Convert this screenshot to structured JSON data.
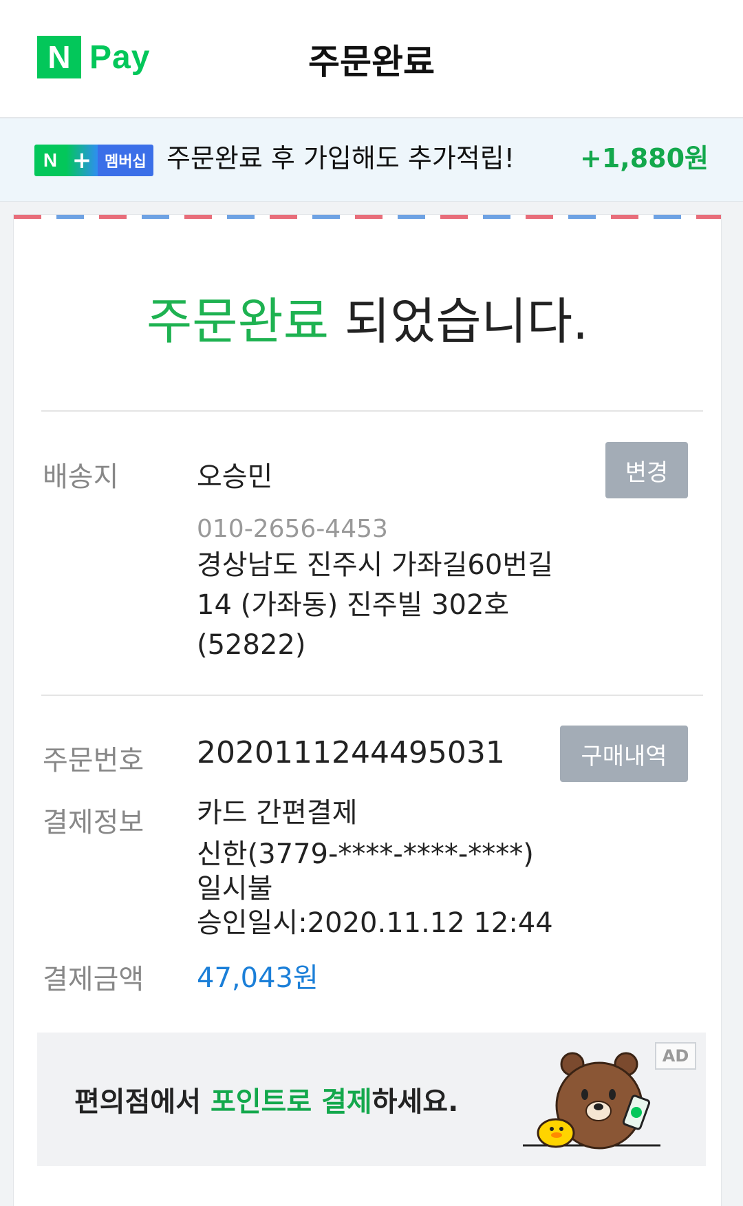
{
  "header": {
    "logo_n": "N",
    "logo_pay": "Pay",
    "title": "주문완료"
  },
  "banner": {
    "badge_n": "N",
    "badge_plus": "+",
    "badge_text": "멤버십",
    "text": "주문완료 후 가입해도 추가적립!",
    "amount": "+1,880원"
  },
  "main": {
    "complete_highlight": "주문완료",
    "complete_rest": " 되었습니다.",
    "shipping": {
      "label": "배송지",
      "name": "오승민",
      "change_button": "변경",
      "phone": "010-2656-4453",
      "address_line1": "경상남도 진주시 가좌길60번길",
      "address_line2": "14 (가좌동) 진주빌 302호",
      "postal": "(52822)"
    },
    "order": {
      "label": "주문번호",
      "number": "2020111244495031",
      "history_button": "구매내역"
    },
    "payment": {
      "label": "결제정보",
      "method": "카드 간편결제",
      "card": "신한(3779-****-****-****)",
      "installment": "일시불",
      "approval": "승인일시:2020.11.12 12:44"
    },
    "amount": {
      "label": "결제금액",
      "value": "47,043원"
    }
  },
  "ad": {
    "text_before": "편의점에서 ",
    "text_highlight": "포인트로 결제",
    "text_after": "하세요.",
    "badge": "AD"
  }
}
